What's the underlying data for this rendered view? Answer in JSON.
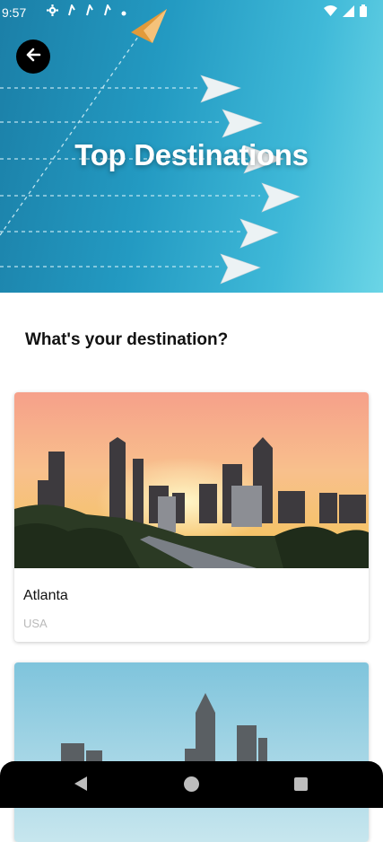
{
  "status_bar": {
    "time": "9:57",
    "left_icons": [
      "settings-icon",
      "signal-icon",
      "signal-icon",
      "signal-icon",
      "dot-icon"
    ],
    "right_icons": [
      "wifi-icon",
      "cellular-icon",
      "battery-icon"
    ]
  },
  "header": {
    "title": "Top Destinations",
    "back_icon": "arrow-left-icon"
  },
  "main": {
    "heading": "What's your destination?",
    "destinations": [
      {
        "name": "Atlanta",
        "country": "USA"
      },
      {
        "name": "",
        "country": ""
      }
    ]
  },
  "nav_bar": {
    "buttons": [
      "back-triangle-icon",
      "home-circle-icon",
      "recents-square-icon"
    ]
  },
  "colors": {
    "hero_gradient_start": "#1b7fa7",
    "hero_gradient_end": "#6bd5e6",
    "nav_bar": "#000000"
  }
}
